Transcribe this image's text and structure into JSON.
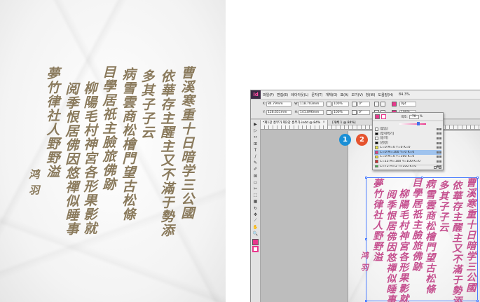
{
  "left_photo": {
    "columns": [
      "曹溪寒重十日暗学三公國",
      "依華存主醒主又不滿于勢添",
      "多其子子云",
      "病雪雲商松檜門望古松條",
      "目學居祇主臉旅佛跡",
      "柳陽毛村神宮各形果影就",
      "阅季恨居佛因悠禪似睡事",
      "夢竹律社人野野溢"
    ],
    "signature": "鸿 羽"
  },
  "app": {
    "logo": "Id",
    "menu": [
      "파일(F)",
      "편집(E)",
      "레이아웃(L)",
      "문자(T)",
      "개체(O)",
      "표(A)",
      "보기(V)",
      "창(W)",
      "도움말(H)"
    ],
    "zoom": "84.3%",
    "control_bar": {
      "x_label": "X:",
      "x_value": "84.79mm",
      "y_label": "Y:",
      "y_value": "128.651mm",
      "w_label": "W:",
      "w_value": "118.703mm",
      "h_label": "H:",
      "h_value": "141.896mm",
      "scale_x": "100%",
      "scale_y": "100%",
      "angle": "0°",
      "shear": "0°",
      "stroke_weight": "0pt",
      "opacity": "100%"
    },
    "doc_tab": {
      "name": "*제1강 흥부가 제2강 흥부가.indd @ 84%",
      "info": "[개체 1 @ 84%]",
      "close": "×"
    },
    "tools": [
      "▶",
      "▷",
      "↔",
      "⊞",
      "T",
      "/",
      "✎",
      "✐",
      "⊠",
      "▭",
      "✂",
      "⬚",
      "▦",
      "↻",
      "✥",
      "⟋",
      "✋",
      "🔍"
    ],
    "swatch_panel": {
      "tint_label": "색조:",
      "tint_value": "70",
      "tint_unit": "%",
      "tint_fraction": 0.7,
      "rows": [
        {
          "name": "[없음]",
          "color": "#ffffff",
          "selected": false
        },
        {
          "name": "[맞춰찍기]",
          "color": "#000000",
          "selected": false
        },
        {
          "name": "[용지]",
          "color": "#ffffff",
          "selected": false
        },
        {
          "name": "[검정]",
          "color": "#000000",
          "selected": false
        },
        {
          "name": "C=0 M=0 Y=0 K=0",
          "color": "#f2ea3a",
          "selected": false
        },
        {
          "name": "C=0 M=100 Y=0 K=0",
          "color": "#e9378d",
          "selected": true
        },
        {
          "name": "C=0 M=0 Y=100 K=0",
          "color": "#f7e12b",
          "selected": false
        },
        {
          "name": "C=15 M=100 Y=100 K=0",
          "color": "#d62b2b",
          "selected": false
        },
        {
          "name": "C=75 M=5 Y=100 K=0",
          "color": "#3ea447",
          "selected": false
        }
      ]
    },
    "badges": [
      {
        "label": "1",
        "color": "#1a8fd6"
      },
      {
        "label": "2",
        "color": "#e5532e"
      }
    ],
    "page_columns": [
      "曹溪寒重十日暗学三公國",
      "依華存主醒主又不滿于勢添",
      "多其子子云",
      "病雪雲商松檜門望古松條",
      "目學居祇主臉旅佛跡",
      "柳陽毛村神宮各形果影就",
      "阅季恨居佛因悠禪似睡事",
      "夢竹律社人野野溢"
    ],
    "page_signature": "鸿 羽",
    "colors": {
      "accent": "#e9378d",
      "ink_photo": "#8a7a5c",
      "ink_page": "#c5508f",
      "selection": "#4a7cff"
    }
  }
}
